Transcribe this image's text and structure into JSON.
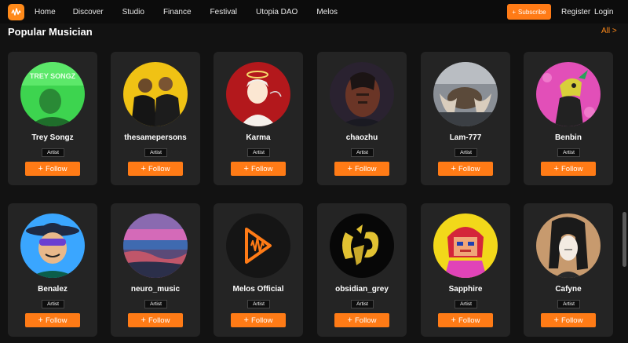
{
  "nav": {
    "items": [
      "Home",
      "Discover",
      "Studio",
      "Finance",
      "Festival",
      "Utopia DAO",
      "Melos"
    ],
    "subscribe_label": "Subscribe",
    "register_label": "Register",
    "login_label": "Login"
  },
  "section": {
    "title": "Popular Musician",
    "all_label": "All >"
  },
  "musicians": [
    {
      "name": "Trey Songz",
      "badge": "Artist",
      "follow_label": "Follow"
    },
    {
      "name": "thesamepersons",
      "badge": "Artist",
      "follow_label": "Follow"
    },
    {
      "name": "Karma",
      "badge": "Artist",
      "follow_label": "Follow"
    },
    {
      "name": "chaozhu",
      "badge": "Artist",
      "follow_label": "Follow"
    },
    {
      "name": "Lam-777",
      "badge": "Artist",
      "follow_label": "Follow"
    },
    {
      "name": "Benbin",
      "badge": "Artist",
      "follow_label": "Follow"
    },
    {
      "name": "Benalez",
      "badge": "Artist",
      "follow_label": "Follow"
    },
    {
      "name": "neuro_music",
      "badge": "Artist",
      "follow_label": "Follow"
    },
    {
      "name": "Melos Official",
      "badge": "Artist",
      "follow_label": "Follow"
    },
    {
      "name": "obsidian_grey",
      "badge": "Artist",
      "follow_label": "Follow"
    },
    {
      "name": "Sapphire",
      "badge": "Artist",
      "follow_label": "Follow"
    },
    {
      "name": "Cafyne",
      "badge": "Artist",
      "follow_label": "Follow"
    }
  ],
  "colors": {
    "accent": "#ff7b16",
    "background": "#121212",
    "card": "#242424"
  },
  "avatar_text": {
    "trey_songz": "TREY SONGZ"
  }
}
